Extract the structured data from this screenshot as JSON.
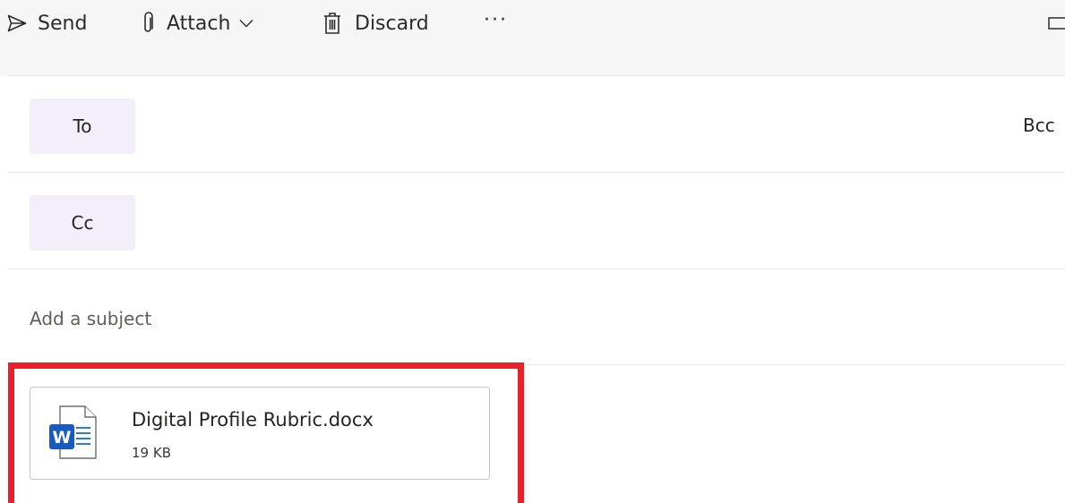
{
  "toolbar": {
    "send_label": "Send",
    "attach_label": "Attach",
    "discard_label": "Discard",
    "more_label": "···"
  },
  "recipients": {
    "to_label": "To",
    "cc_label": "Cc",
    "bcc_label": "Bcc"
  },
  "subject": {
    "placeholder": "Add a subject",
    "value": ""
  },
  "attachment": {
    "file_name": "Digital Profile Rubric.docx",
    "file_size": "19 KB",
    "file_icon": "word-doc-icon"
  },
  "colors": {
    "highlight_border": "#e8202a",
    "word_blue": "#185abd",
    "pill_bg": "#f3effa"
  }
}
